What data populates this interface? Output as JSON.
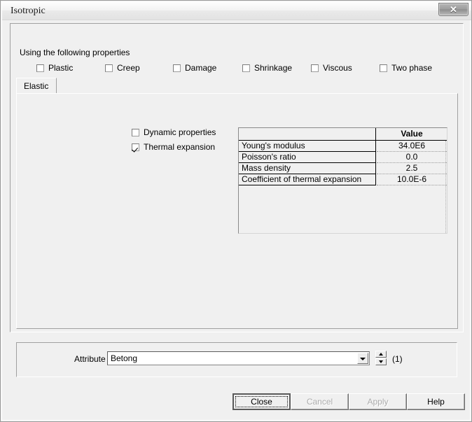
{
  "window": {
    "title": "Isotropic",
    "close_icon": "close-x-icon"
  },
  "content": {
    "using_label": "Using the following properties",
    "model_checkboxes": [
      {
        "label": "Plastic",
        "checked": false
      },
      {
        "label": "Creep",
        "checked": false
      },
      {
        "label": "Damage",
        "checked": false
      },
      {
        "label": "Shrinkage",
        "checked": false
      },
      {
        "label": "Viscous",
        "checked": false
      },
      {
        "label": "Two phase",
        "checked": false
      }
    ],
    "tabs": [
      {
        "label": "Elastic",
        "selected": true
      }
    ],
    "option_checkboxes": [
      {
        "label": "Dynamic properties",
        "checked": false
      },
      {
        "label": "Thermal expansion",
        "checked": true
      }
    ],
    "property_table": {
      "headers": [
        "",
        "Value"
      ],
      "rows": [
        {
          "name": "Young's modulus",
          "value": "34.0E6"
        },
        {
          "name": "Poisson's ratio",
          "value": "0.0"
        },
        {
          "name": "Mass density",
          "value": "2.5"
        },
        {
          "name": "Coefficient of thermal expansion",
          "value": "10.0E-6"
        }
      ]
    }
  },
  "attribute": {
    "label": "Attribute",
    "value": "Betong",
    "placeholder": "",
    "dropdown_icon": "chevron-down-icon",
    "spinner_up_icon": "spinner-up-icon",
    "spinner_down_icon": "spinner-down-icon",
    "count": "(1)"
  },
  "buttons": {
    "close": {
      "label": "Close",
      "enabled": true,
      "default": true
    },
    "cancel": {
      "label": "Cancel",
      "enabled": false,
      "default": false
    },
    "apply": {
      "label": "Apply",
      "enabled": false,
      "default": false
    },
    "help": {
      "label": "Help",
      "enabled": true,
      "default": false
    }
  }
}
